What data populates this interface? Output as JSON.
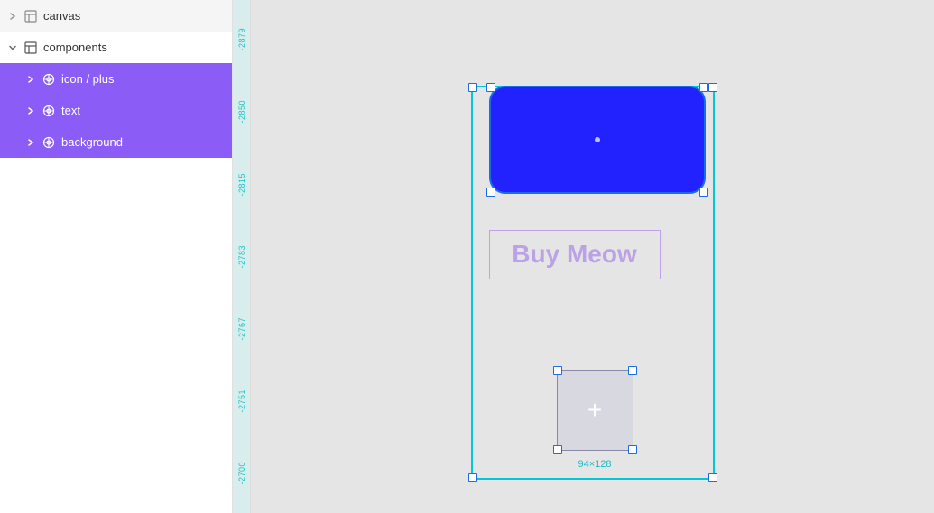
{
  "sidebar": {
    "canvas_label": "canvas",
    "components_label": "components",
    "items": [
      {
        "id": "icon-plus",
        "label": "icon / plus",
        "selected": true
      },
      {
        "id": "text",
        "label": "text",
        "selected": true
      },
      {
        "id": "background",
        "label": "background",
        "selected": true
      }
    ]
  },
  "ruler": {
    "labels": [
      "-2879",
      "-2850",
      "-2815",
      "-2783",
      "-2767",
      "-2751",
      "-2700"
    ]
  },
  "canvas": {
    "blue_rect_center": "·",
    "buy_meow_text": "Buy Meow",
    "plus_label": "+",
    "dimension_label": "94×128"
  }
}
